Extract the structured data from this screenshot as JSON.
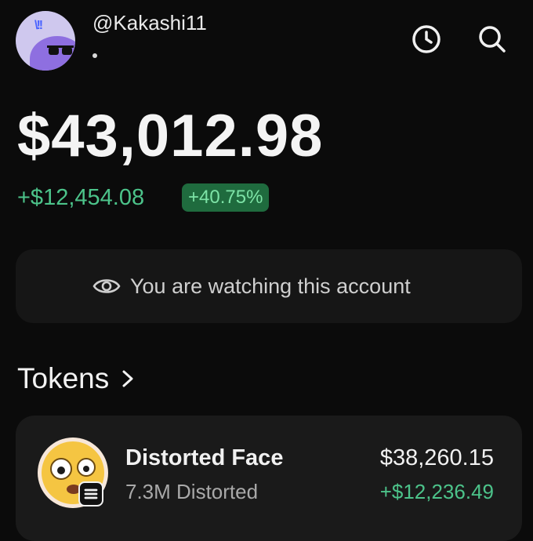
{
  "header": {
    "username": "@Kakashi11",
    "history_icon": "clock-icon",
    "search_icon": "search-icon"
  },
  "portfolio": {
    "balance": "$43,012.98",
    "change": "+$12,454.08",
    "change_pct": "+40.75%"
  },
  "watch_notice": {
    "text": "You are watching this account",
    "icon": "eye-icon"
  },
  "tokens": {
    "title": "Tokens",
    "items": [
      {
        "name": "Distorted Face",
        "amount": "7.3M Distorted",
        "value": "$38,260.15",
        "gain": "+$12,236.49"
      }
    ]
  },
  "colors": {
    "background": "#0b0b0b",
    "card": "#161616",
    "positive": "#4cc38a",
    "badge_bg": "#1f6b3e"
  }
}
